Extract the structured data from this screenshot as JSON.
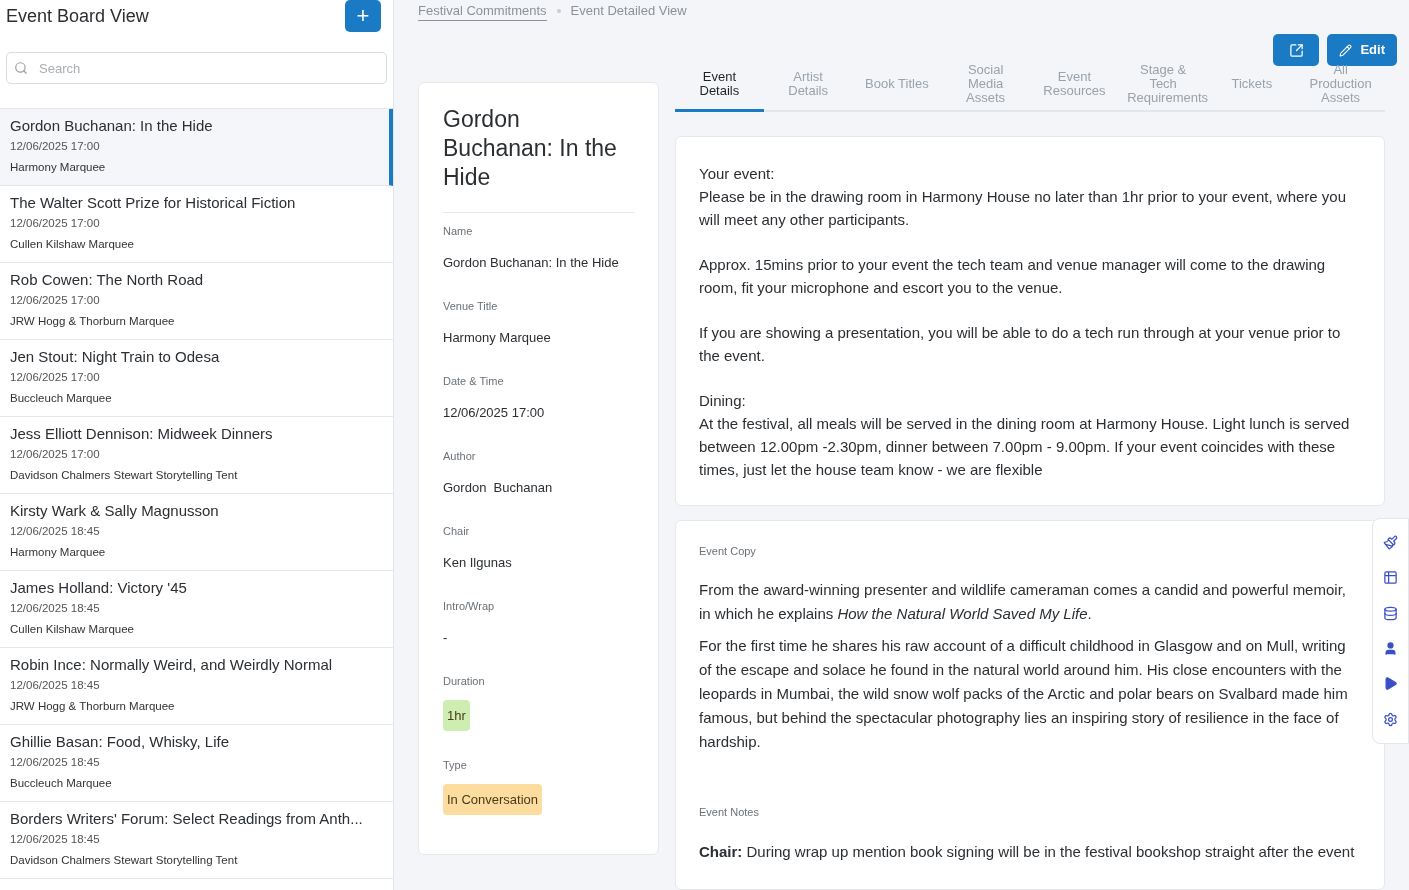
{
  "sidebar": {
    "title": "Event Board View",
    "add_button": "+",
    "search": {
      "placeholder": "Search"
    },
    "events": [
      {
        "title": "Gordon Buchanan: In the Hide",
        "datetime": "12/06/2025 17:00",
        "venue": "Harmony Marquee",
        "selected": true
      },
      {
        "title": "The Walter Scott Prize for Historical Fiction",
        "datetime": "12/06/2025 17:00",
        "venue": "Cullen Kilshaw Marquee",
        "selected": false
      },
      {
        "title": "Rob Cowen: The North Road",
        "datetime": "12/06/2025 17:00",
        "venue": "JRW Hogg & Thorburn Marquee",
        "selected": false
      },
      {
        "title": "Jen Stout: Night Train to Odesa",
        "datetime": "12/06/2025 17:00",
        "venue": "Buccleuch Marquee",
        "selected": false
      },
      {
        "title": "Jess Elliott Dennison: Midweek Dinners",
        "datetime": "12/06/2025 17:00",
        "venue": "Davidson Chalmers Stewart Storytelling Tent",
        "selected": false
      },
      {
        "title": "Kirsty Wark & Sally Magnusson",
        "datetime": "12/06/2025 18:45",
        "venue": "Harmony Marquee",
        "selected": false
      },
      {
        "title": "James Holland: Victory '45",
        "datetime": "12/06/2025 18:45",
        "venue": "Cullen Kilshaw Marquee",
        "selected": false
      },
      {
        "title": "Robin Ince: Normally Weird, and Weirdly Normal",
        "datetime": "12/06/2025 18:45",
        "venue": "JRW Hogg & Thorburn Marquee",
        "selected": false
      },
      {
        "title": "Ghillie Basan: Food, Whisky, Life",
        "datetime": "12/06/2025 18:45",
        "venue": "Buccleuch Marquee",
        "selected": false
      },
      {
        "title": "Borders Writers' Forum: Select Readings from Anth...",
        "datetime": "12/06/2025 18:45",
        "venue": "Davidson Chalmers Stewart Storytelling Tent",
        "selected": false
      }
    ]
  },
  "breadcrumb": [
    "Festival Commitments",
    "Event Detailed View"
  ],
  "actions": {
    "edit": "Edit"
  },
  "summary": {
    "title": "Gordon Buchanan: In the Hide",
    "fields": [
      {
        "label": "Name",
        "value": "Gordon Buchanan: In the Hide",
        "kind": "text"
      },
      {
        "label": "Venue Title",
        "value": "Harmony Marquee",
        "kind": "text"
      },
      {
        "label": "Date & Time",
        "value": "12/06/2025 17:00",
        "kind": "text"
      },
      {
        "label": "Author",
        "value": "Gordon  Buchanan",
        "kind": "text"
      },
      {
        "label": "Chair",
        "value": "Ken Ilgunas",
        "kind": "text"
      },
      {
        "label": "Intro/Wrap",
        "value": "-",
        "kind": "text"
      },
      {
        "label": "Duration",
        "value": "1hr",
        "kind": "tag",
        "color": "#cdeeb0"
      },
      {
        "label": "Type",
        "value": "In Conversation",
        "kind": "tag",
        "color": "#fddc9f"
      }
    ]
  },
  "tabs": [
    {
      "label": "Event Details",
      "selected": true
    },
    {
      "label": "Artist Details",
      "selected": false
    },
    {
      "label": "Book Titles",
      "selected": false
    },
    {
      "label": "Social Media Assets",
      "selected": false
    },
    {
      "label": "Event Resources",
      "selected": false
    },
    {
      "label": "Stage & Tech Requirements",
      "selected": false
    },
    {
      "label": "Tickets",
      "selected": false
    },
    {
      "label": "All Production Assets",
      "selected": false
    }
  ],
  "info_card": {
    "blocks": [
      {
        "heading": "Your event:",
        "text": "Please be in the drawing room in Harmony House no later than 1hr prior to your event, where you will meet any other participants."
      },
      {
        "text": "Approx. 15mins prior to your event the tech team and venue manager will come to the drawing room, fit your microphone and escort you to the venue."
      },
      {
        "text": "If you are showing a presentation, you will be able to do a tech run through at your venue prior to the event."
      },
      {
        "heading": "Dining:",
        "text": "At the festival, all meals will be served in the dining room at Harmony House. Light lunch is served between 12.00pm -2.30pm, dinner between 7.00pm - 9.00pm. If your event coincides with these times, just let the house team know - we are flexible"
      }
    ]
  },
  "copy_card": {
    "label": "Event Copy",
    "paragraphs": [
      "From the award-winning presenter and wildlife cameraman comes a candid and powerful memoir, in which he explains *How the Natural World Saved My Life*.",
      "For the first time he shares his raw account of a difficult childhood in Glasgow and on Mull, writing of the escape and solace he found in the natural world around him. His close encounters with the leopards in Mumbai, the wild snow wolf packs of the Arctic and polar bears on Svalbard made him famous, but behind the spectacular photography lies an inspiring story of resilience in the face of hardship."
    ],
    "notes_label": "Event Notes",
    "notes": "**Chair:** During wrap up mention book signing will be in the festival bookshop straight after the event"
  },
  "side_rail": [
    {
      "kind": "brush"
    },
    {
      "kind": "table"
    },
    {
      "kind": "database"
    },
    {
      "kind": "user"
    },
    {
      "kind": "play"
    },
    {
      "kind": "gear"
    }
  ]
}
